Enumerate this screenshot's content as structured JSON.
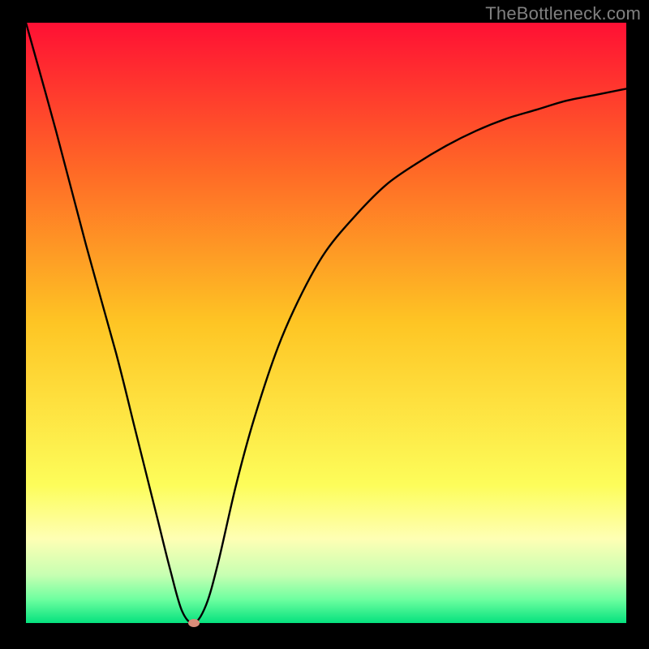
{
  "watermark": "TheBottleneck.com",
  "chart_data": {
    "type": "line",
    "title": "",
    "xlabel": "",
    "ylabel": "",
    "xlim": [
      0,
      100
    ],
    "ylim": [
      0,
      100
    ],
    "grid": false,
    "legend": false,
    "background": "rainbow_gradient_red_to_green_vertical",
    "series": [
      {
        "name": "bottleneck_curve",
        "x": [
          0,
          5,
          10,
          15,
          18,
          20,
          22,
          24,
          26,
          28,
          30,
          32,
          35,
          38,
          42,
          46,
          50,
          55,
          60,
          65,
          70,
          75,
          80,
          85,
          90,
          95,
          100
        ],
        "y": [
          100,
          82,
          63,
          45,
          33,
          25,
          17,
          9,
          2,
          0,
          3,
          10,
          23,
          34,
          46,
          55,
          62,
          68,
          73,
          76.5,
          79.5,
          82,
          84,
          85.5,
          87,
          88,
          89
        ]
      }
    ],
    "marker": {
      "name": "optimal_point",
      "x": 28,
      "y": 0,
      "color": "#d98d7a"
    },
    "gradient_stops": [
      {
        "offset": 0.0,
        "color": "#ff1034"
      },
      {
        "offset": 0.25,
        "color": "#ff6a26"
      },
      {
        "offset": 0.5,
        "color": "#fec524"
      },
      {
        "offset": 0.77,
        "color": "#fdfd5a"
      },
      {
        "offset": 0.86,
        "color": "#feffb4"
      },
      {
        "offset": 0.92,
        "color": "#c7ffb2"
      },
      {
        "offset": 0.96,
        "color": "#6fffa0"
      },
      {
        "offset": 1.0,
        "color": "#05e27e"
      }
    ]
  }
}
